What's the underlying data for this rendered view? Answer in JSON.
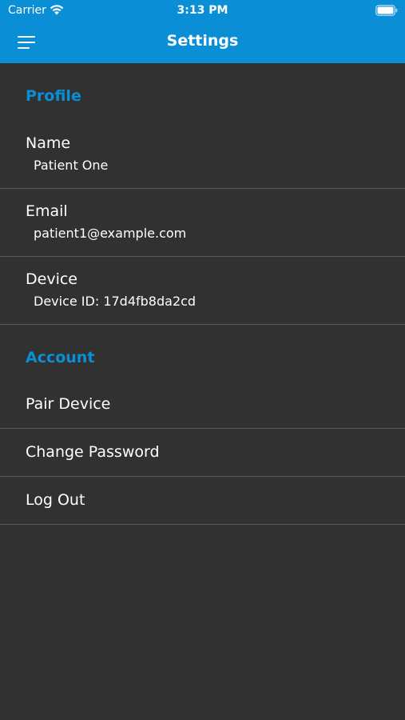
{
  "status_bar": {
    "carrier": "Carrier",
    "time": "3:13 PM",
    "wifi_icon": "wifi-icon",
    "battery_icon": "battery-icon"
  },
  "nav_bar": {
    "title": "Settings",
    "menu_icon": "hamburger-menu-icon",
    "background_color": "#0a8fd6"
  },
  "profile_section": {
    "header": "Profile",
    "items": [
      {
        "title": "Name",
        "value": "Patient One"
      },
      {
        "title": "Email",
        "value": "patient1@example.com"
      },
      {
        "title": "Device",
        "value": "Device ID: 17d4fb8da2cd"
      }
    ]
  },
  "account_section": {
    "header": "Account",
    "items": [
      {
        "title": "Pair Device"
      },
      {
        "title": "Change Password"
      },
      {
        "title": "Log Out"
      }
    ]
  },
  "colors": {
    "accent": "#0a8fd6",
    "background": "#323131",
    "divider": "#5a5a5a",
    "text": "#ffffff"
  }
}
